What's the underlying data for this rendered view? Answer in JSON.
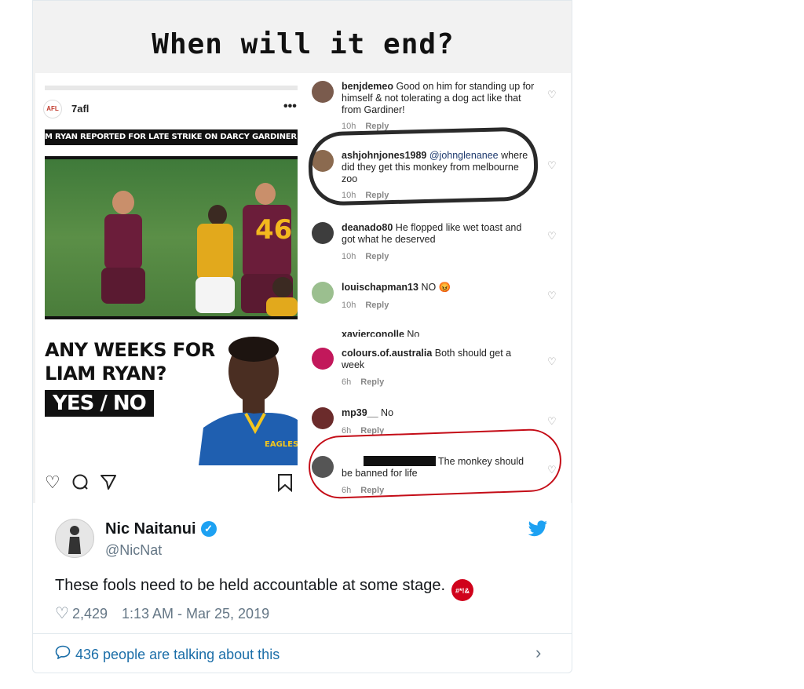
{
  "story": {
    "caption": "When will it end?"
  },
  "post": {
    "username": "7afl",
    "more": "•••",
    "banner": "M RYAN REPORTED FOR LATE STRIKE ON DARCY GARDINER",
    "jersey_number": "46",
    "poll_question": "ANY WEEKS FOR\nLIAM RYAN?",
    "poll_answer": "YES / NO"
  },
  "comments": [
    {
      "user": "benjdemeo",
      "mention": "",
      "text": "Good on him for standing up for himself & not tolerating a dog act like that from Gardiner!",
      "time": "10h",
      "reply": "Reply",
      "avatar_color": "#7a5b4d"
    },
    {
      "user": "ashjohnjones1989",
      "mention": "@johnglenanee",
      "text": "where did they get this monkey from melbourne zoo",
      "time": "10h",
      "reply": "Reply",
      "avatar_color": "#8b6a4f"
    },
    {
      "user": "deanado80",
      "mention": "",
      "text": "He flopped like wet toast and got what he deserved",
      "time": "10h",
      "reply": "Reply",
      "avatar_color": "#3d3d3d"
    },
    {
      "user": "louischapman13",
      "mention": "",
      "text": "NO 😡",
      "time": "10h",
      "reply": "Reply",
      "avatar_color": "#9bbf8f"
    },
    {
      "user": "xavierconolle",
      "mention": "",
      "text": "No",
      "time": "",
      "reply": "",
      "avatar_color": "#bbbbbb"
    },
    {
      "user": "colours.of.australia",
      "mention": "",
      "text": "Both should get a week",
      "time": "6h",
      "reply": "Reply",
      "avatar_color": "#c2185b"
    },
    {
      "user": "mp39__",
      "mention": "",
      "text": "No",
      "time": "6h",
      "reply": "Reply",
      "avatar_color": "#6b2b2b"
    },
    {
      "user": "",
      "mention": "",
      "text": "The monkey should be banned for life",
      "time": "6h",
      "reply": "Reply",
      "avatar_color": "#555555"
    }
  ],
  "tweet": {
    "name": "Nic Naitanui",
    "handle": "@NicNat",
    "text": "These fools need to be held accountable at some stage.",
    "likes": "2,429",
    "timestamp": "1:13 AM - Mar 25, 2019",
    "talking": "436 people are talking about this",
    "accent": "#1da1f2",
    "icons": [
      "verified-icon",
      "twitter-bird-icon",
      "heart-icon",
      "comment-bubble-icon",
      "chevron-right-icon",
      "angry-emoji-icon"
    ]
  }
}
